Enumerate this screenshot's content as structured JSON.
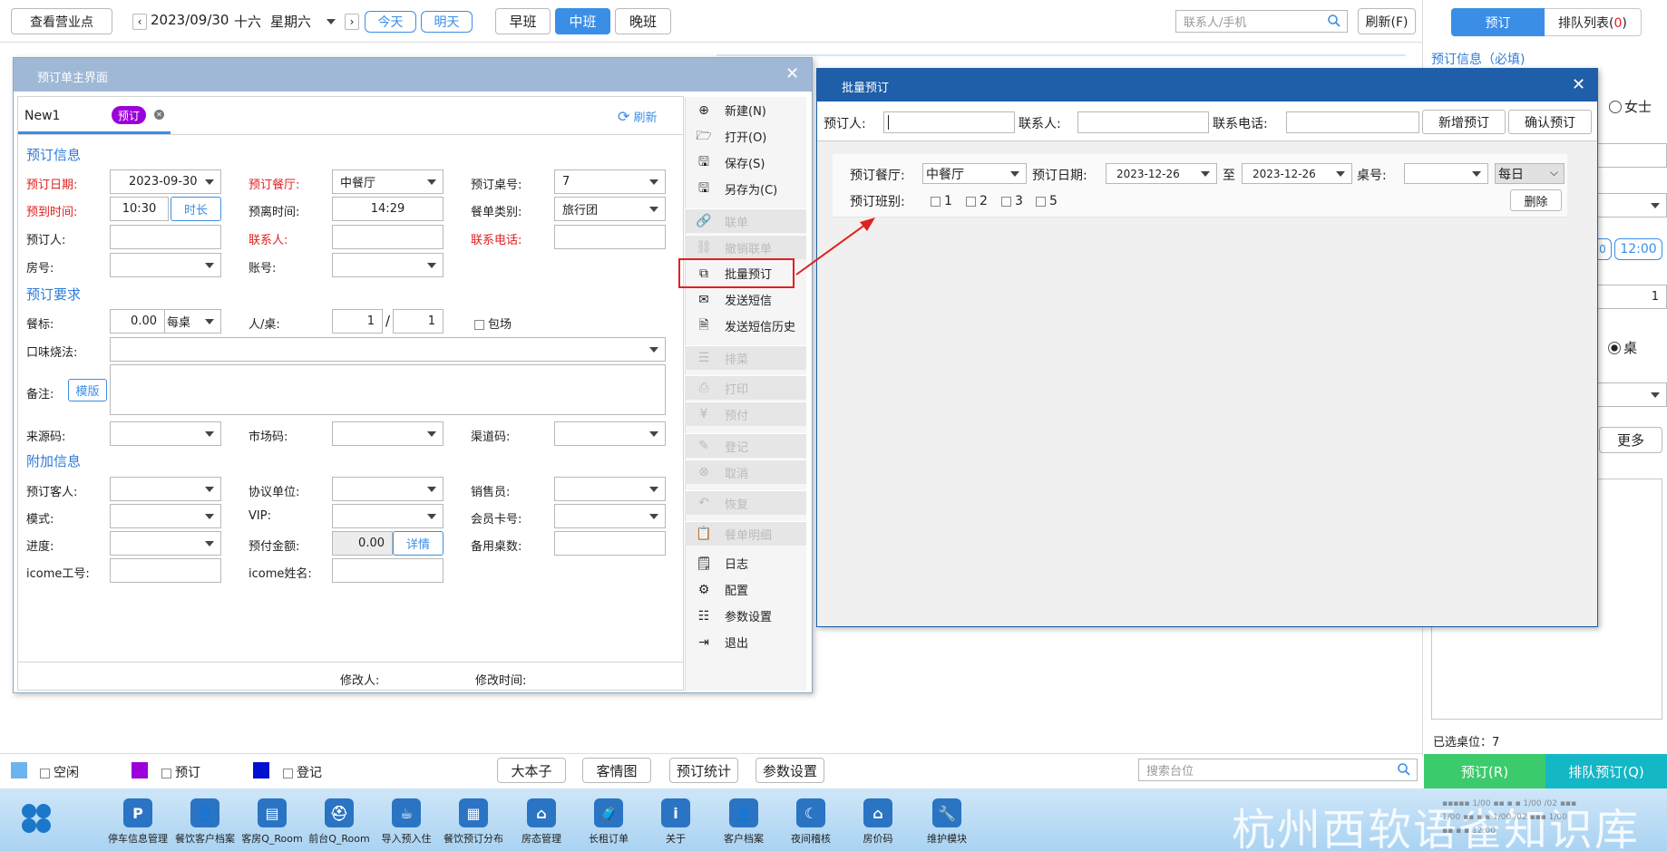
{
  "topbar": {
    "view_outlets": "查看营业点",
    "date": "2023/09/30",
    "lunar": "十六",
    "weekday": "星期六",
    "today": "今天",
    "tomorrow": "明天",
    "shifts": [
      "早班",
      "中班",
      "晚班"
    ],
    "search_placeholder": "联系人/手机",
    "refresh": "刷新(F)"
  },
  "right_panel": {
    "tab_reserve": "预订",
    "tab_queue": "排队列表(",
    "queue_count": "0",
    "tab_close": ")",
    "info_title": "预订信息（必填)",
    "female": "女士",
    "time_1200": "12:00",
    "value_1": "1",
    "table": "桌",
    "more": "更多",
    "selected_tables": "已选桌位：7",
    "btn_reserve": "预订(R)",
    "btn_queue": "排队预订(Q)",
    "partial_text": "▪▪▪▪▪ 1/00 ▪▪ ▪ ▪ 1/00 /02 ▪▪▪ 1/00 ▪▪ ▪ ▪ 1/00 /02 ▪▪▪ 1/00 ▪▪ ▪ ▪ 12:00"
  },
  "main_dialog": {
    "title": "预订单主界面",
    "tab": "New1",
    "badge": "预订",
    "refresh": "刷新",
    "section_info": "预订信息",
    "date_label": "预订日期:",
    "date_value": "2023-09-30",
    "hall_label": "预订餐厅:",
    "hall_value": "中餐厅",
    "table_label": "预订桌号:",
    "table_value": "7",
    "arrive_label": "预到时间:",
    "arrive_value": "10:30",
    "duration": "时长",
    "leave_label": "预离时间:",
    "leave_value": "14:29",
    "category_label": "餐单类别:",
    "category_value": "旅行团",
    "booker_label": "预订人:",
    "contact_label": "联系人:",
    "phone_label": "联系电话:",
    "room_label": "房号:",
    "account_label": "账号:",
    "section_req": "预订要求",
    "standard_label": "餐标:",
    "standard_value": "0.00",
    "per_table": "每桌",
    "people_label": "人/桌:",
    "people_value": "1",
    "slash": "/",
    "people_value2": "1",
    "whole": "包场",
    "taste_label": "口味烧法:",
    "remark_label": "备注:",
    "template": "模版",
    "source_label": "来源码:",
    "market_label": "市场码:",
    "channel_label": "渠道码:",
    "section_extra": "附加信息",
    "guest_label": "预订客人:",
    "agreement_label": "协议单位:",
    "sales_label": "销售员:",
    "mode_label": "模式:",
    "vip_label": "VIP:",
    "member_label": "会员卡号:",
    "progress_label": "进度:",
    "deposit_label": "预付金额:",
    "deposit_value": "0.00",
    "detail": "详情",
    "spare_label": "备用桌数:",
    "icome_id_label": "icome工号:",
    "icome_name_label": "icome姓名:",
    "modifier_label": "修改人:",
    "modified_time_label": "修改时间:",
    "menu": [
      {
        "label": "新建(N)",
        "icon": "plus-circle-icon",
        "enabled": true
      },
      {
        "label": "打开(O)",
        "icon": "folder-open-icon",
        "enabled": true
      },
      {
        "label": "保存(S)",
        "icon": "save-icon",
        "enabled": true
      },
      {
        "label": "另存为(C)",
        "icon": "save-as-icon",
        "enabled": true
      },
      {
        "label": "联单",
        "icon": "link-icon",
        "enabled": false
      },
      {
        "label": "撤销联单",
        "icon": "unlink-icon",
        "enabled": false
      },
      {
        "label": "批量预订",
        "icon": "batch-icon",
        "enabled": true
      },
      {
        "label": "发送短信",
        "icon": "mail-icon",
        "enabled": true
      },
      {
        "label": "发送短信历史",
        "icon": "document-icon",
        "enabled": true
      },
      {
        "label": "排菜",
        "icon": "list-icon",
        "enabled": false
      },
      {
        "label": "打印",
        "icon": "printer-icon",
        "enabled": false
      },
      {
        "label": "预付",
        "icon": "yen-icon",
        "enabled": false
      },
      {
        "label": "登记",
        "icon": "edit-icon",
        "enabled": false
      },
      {
        "label": "取消",
        "icon": "cancel-icon",
        "enabled": false
      },
      {
        "label": "恢复",
        "icon": "undo-icon",
        "enabled": false
      },
      {
        "label": "餐单明细",
        "icon": "clipboard-icon",
        "enabled": false
      },
      {
        "label": "日志",
        "icon": "log-icon",
        "enabled": true
      },
      {
        "label": "配置",
        "icon": "gear-icon",
        "enabled": true
      },
      {
        "label": "参数设置",
        "icon": "settings-list-icon",
        "enabled": true
      },
      {
        "label": "退出",
        "icon": "exit-icon",
        "enabled": true
      }
    ]
  },
  "batch_dialog": {
    "title": "批量预订",
    "booker_label": "预订人:",
    "contact_label": "联系人:",
    "phone_label": "联系电话:",
    "add_button": "新增预订",
    "confirm_button": "确认预订",
    "hall_label": "预订餐厅:",
    "hall_value": "中餐厅",
    "date_label": "预订日期:",
    "date_from": "2023-12-26",
    "to": "至",
    "date_to": "2023-12-26",
    "table_label": "桌号:",
    "repeat_value": "每日",
    "shift_label": "预订班别:",
    "shifts": [
      "1",
      "2",
      "3",
      "5"
    ],
    "delete": "删除"
  },
  "legend": {
    "idle": "空闲",
    "reserved": "预订",
    "checked_in": "登记",
    "idle_color": "#6cb4ee",
    "reserved_color": "#9b00d9",
    "checked_in_color": "#0010d0"
  },
  "bottom_buttons": [
    "大本子",
    "客情图",
    "预订统计",
    "参数设置"
  ],
  "table_search_placeholder": "搜索台位",
  "taskbar": [
    {
      "label": "停车信息管理",
      "icon": "parking-icon"
    },
    {
      "label": "餐饮客户档案",
      "icon": "customer-icon"
    },
    {
      "label": "客房Q_Room",
      "icon": "room-icon"
    },
    {
      "label": "前台Q_Room",
      "icon": "front-desk-icon"
    },
    {
      "label": "导入预入住",
      "icon": "import-icon"
    },
    {
      "label": "餐饮预订分布",
      "icon": "chart-icon"
    },
    {
      "label": "房态管理",
      "icon": "house-icon"
    },
    {
      "label": "长租订单",
      "icon": "luggage-icon"
    },
    {
      "label": "关于",
      "icon": "info-icon"
    },
    {
      "label": "客户档案",
      "icon": "profile-icon"
    },
    {
      "label": "夜间稽核",
      "icon": "moon-icon"
    },
    {
      "label": "房价码",
      "icon": "price-icon"
    },
    {
      "label": "维护模块",
      "icon": "wrench-icon"
    }
  ],
  "watermark": "杭州西软语雀知识库"
}
